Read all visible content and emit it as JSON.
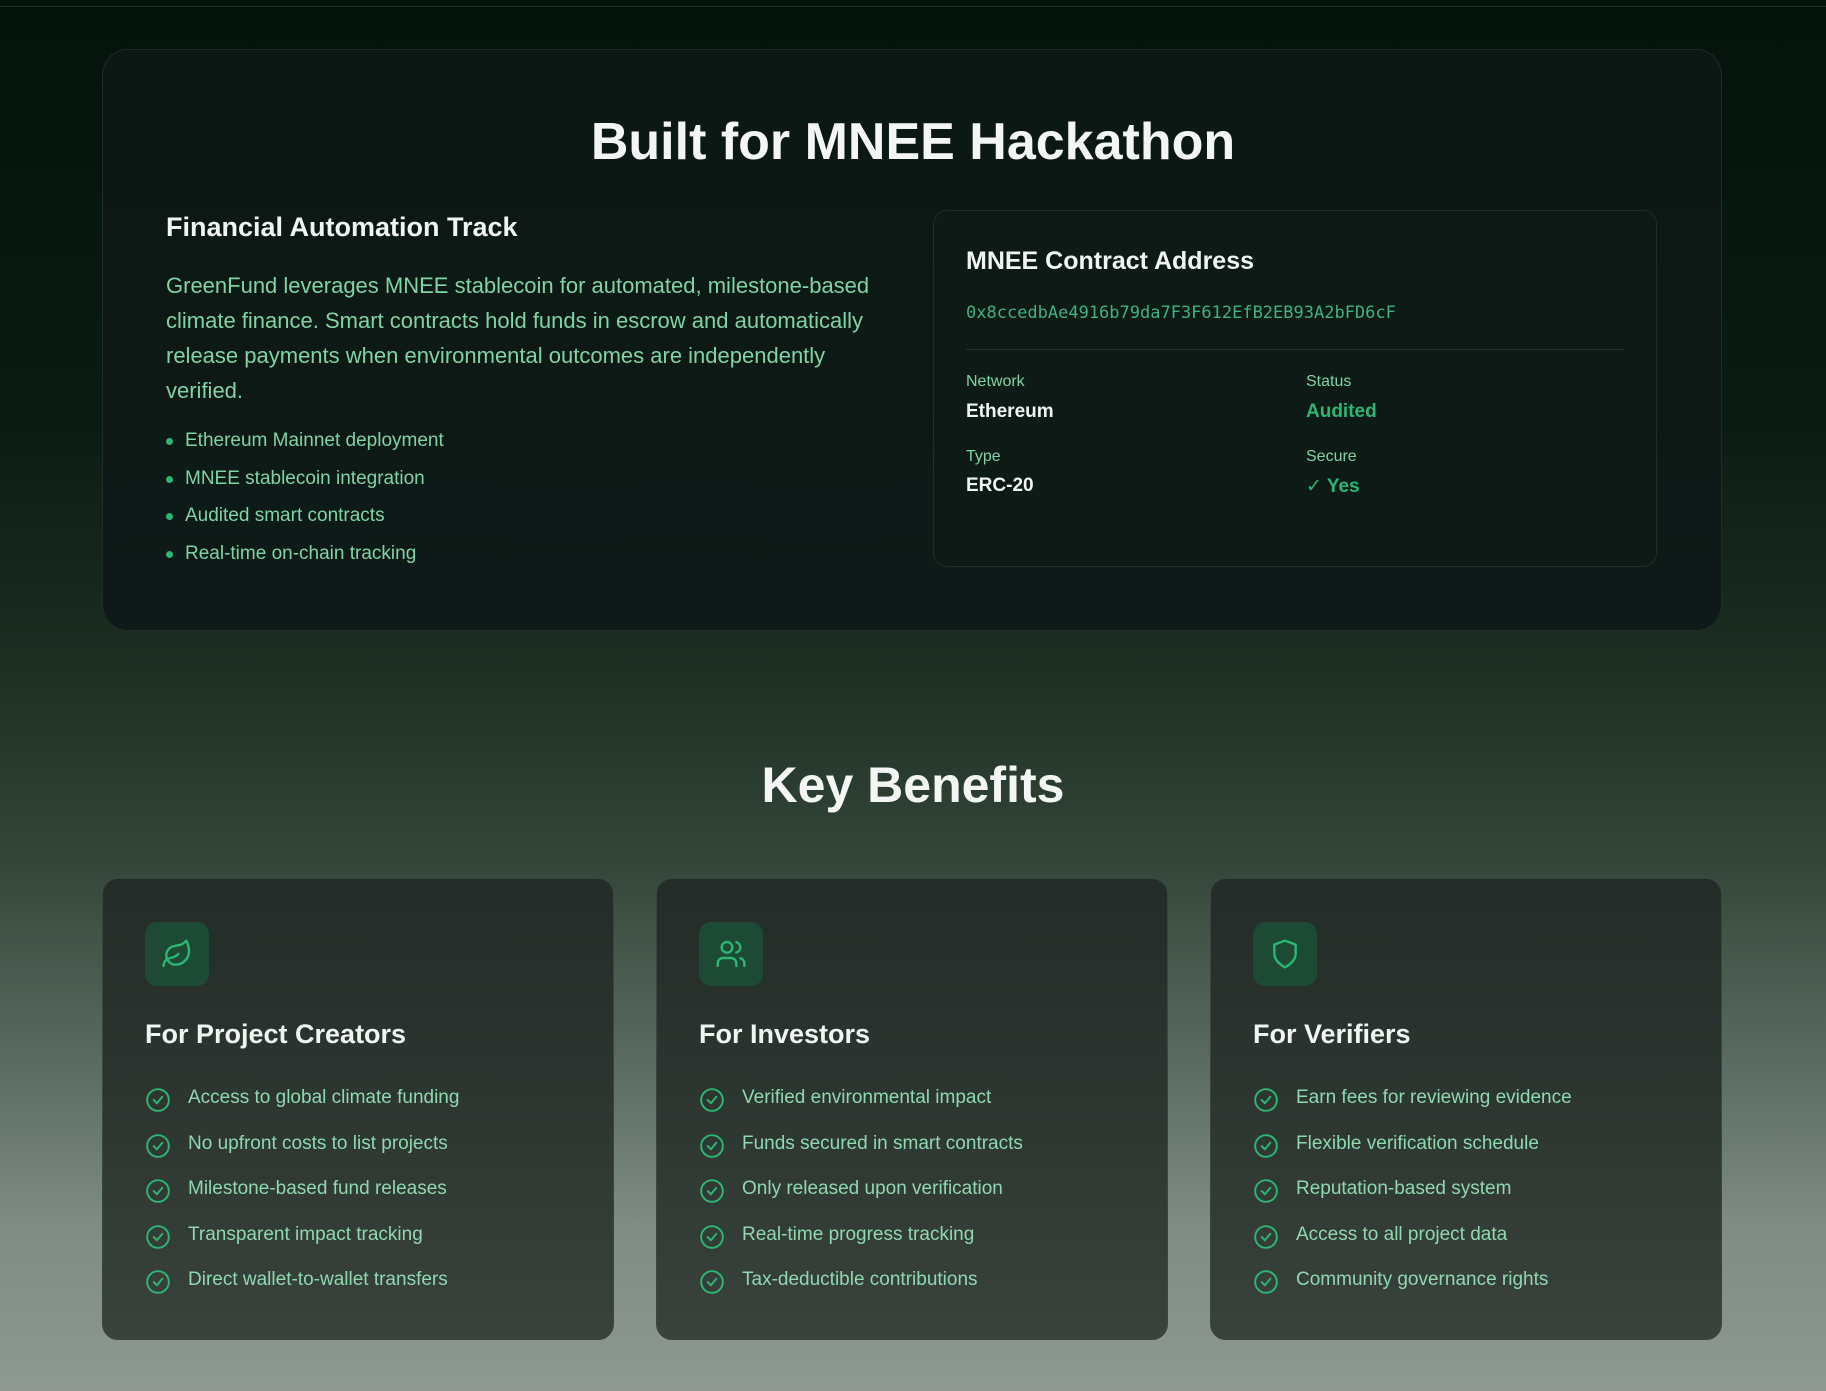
{
  "hackathon": {
    "title": "Built for MNEE Hackathon",
    "track_title": "Financial Automation Track",
    "description": "GreenFund leverages MNEE stablecoin for automated, milestone-based climate finance. Smart contracts hold funds in escrow and automatically release payments when environmental outcomes are independently verified.",
    "features": [
      "Ethereum Mainnet deployment",
      "MNEE stablecoin integration",
      "Audited smart contracts",
      "Real-time on-chain tracking"
    ]
  },
  "contract": {
    "title": "MNEE Contract Address",
    "address": "0x8ccedbAe4916b79da7F3F612EfB2EB93A2bFD6cF",
    "network_label": "Network",
    "network_value": "Ethereum",
    "status_label": "Status",
    "status_value": "Audited",
    "type_label": "Type",
    "type_value": "ERC-20",
    "secure_label": "Secure",
    "secure_value": "✓ Yes"
  },
  "benefits": {
    "title": "Key Benefits",
    "cards": [
      {
        "icon": "leaf-icon",
        "title": "For Project Creators",
        "items": [
          "Access to global climate funding",
          "No upfront costs to list projects",
          "Milestone-based fund releases",
          "Transparent impact tracking",
          "Direct wallet-to-wallet transfers"
        ]
      },
      {
        "icon": "users-icon",
        "title": "For Investors",
        "items": [
          "Verified environmental impact",
          "Funds secured in smart contracts",
          "Only released upon verification",
          "Real-time progress tracking",
          "Tax-deductible contributions"
        ]
      },
      {
        "icon": "shield-icon",
        "title": "For Verifiers",
        "items": [
          "Earn fees for reviewing evidence",
          "Flexible verification schedule",
          "Reputation-based system",
          "Access to all project data",
          "Community governance rights"
        ]
      }
    ]
  },
  "colors": {
    "accent": "#2cb672",
    "text_green": "#7fd4a4",
    "icon_bg": "#1d4a35"
  }
}
